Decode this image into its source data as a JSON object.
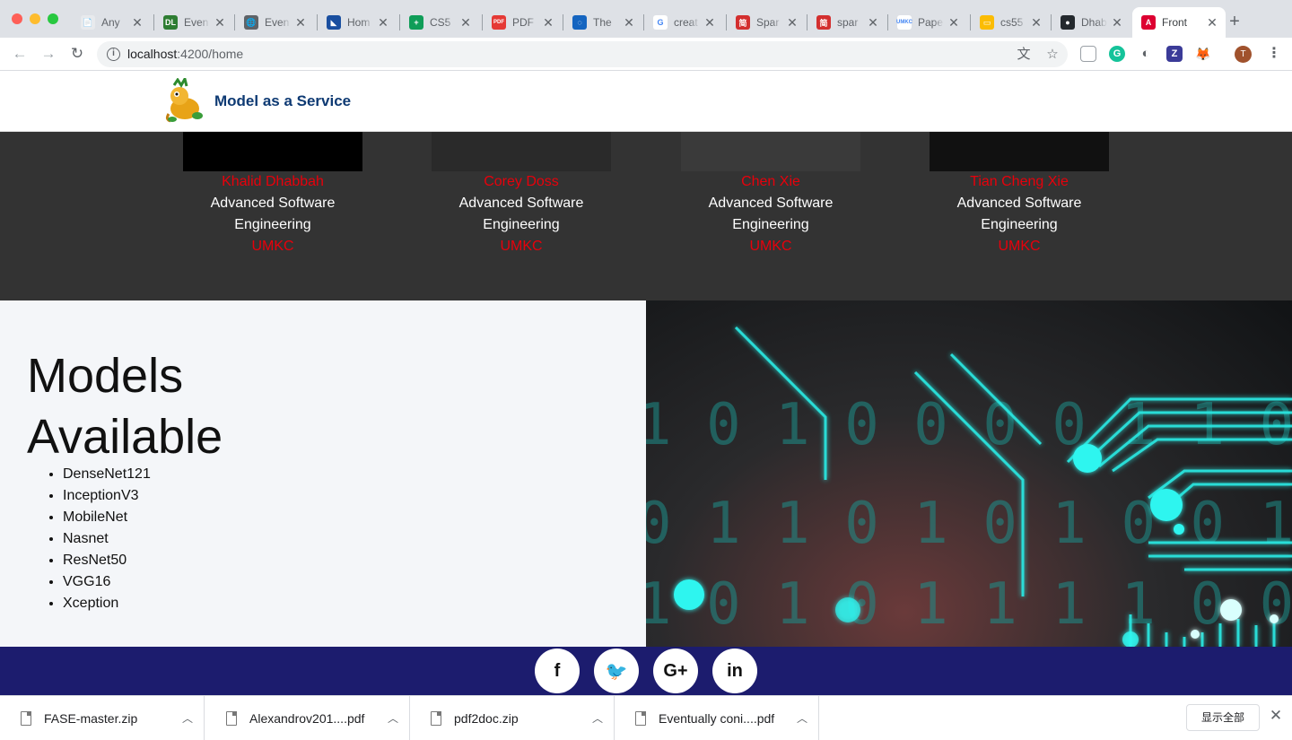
{
  "browser": {
    "tabs": [
      {
        "title": "Any",
        "fav_color": "#e8eaed",
        "fav_glyph": "📄"
      },
      {
        "title": "Even",
        "fav_color": "#2e7d32",
        "fav_glyph": "DL"
      },
      {
        "title": "Even",
        "fav_color": "#5f6368",
        "fav_glyph": "🌐"
      },
      {
        "title": "Hom",
        "fav_color": "#1a4fa0",
        "fav_glyph": "◣"
      },
      {
        "title": "CS5",
        "fav_color": "#0f9d58",
        "fav_glyph": "+"
      },
      {
        "title": "PDF",
        "fav_color": "#e53935",
        "fav_glyph": "PDF"
      },
      {
        "title": "The",
        "fav_color": "#1565c0",
        "fav_glyph": "◌"
      },
      {
        "title": "creat",
        "fav_color": "#ffffff",
        "fav_glyph": "G"
      },
      {
        "title": "Spar",
        "fav_color": "#d32f2f",
        "fav_glyph": "简"
      },
      {
        "title": "spar",
        "fav_color": "#d32f2f",
        "fav_glyph": "简"
      },
      {
        "title": "Pape",
        "fav_color": "#ffffff",
        "fav_glyph": "UMKC"
      },
      {
        "title": "cs55",
        "fav_color": "#fbbc04",
        "fav_glyph": "▭"
      },
      {
        "title": "Dhab",
        "fav_color": "#24292e",
        "fav_glyph": "●"
      },
      {
        "title": "Front",
        "fav_color": "#dd0031",
        "fav_glyph": "A"
      }
    ],
    "address": {
      "host": "localhost",
      "path": ":4200/home"
    }
  },
  "site": {
    "brand": "Model as a Service",
    "team": [
      {
        "name": "Khalid Dhabbah",
        "course": "Advanced Software Engineering",
        "school": "UMKC"
      },
      {
        "name": "Corey Doss",
        "course": "Advanced Software Engineering",
        "school": "UMKC"
      },
      {
        "name": "Chen Xie",
        "course": "Advanced Software Engineering",
        "school": "UMKC"
      },
      {
        "name": "Tian Cheng Xie",
        "course": "Advanced Software Engineering",
        "school": "UMKC"
      }
    ],
    "models_heading": "Models Available",
    "models": [
      "DenseNet121",
      "InceptionV3",
      "MobileNet",
      "Nasnet",
      "ResNet50",
      "VGG16",
      "Xception"
    ],
    "circuit_digits": [
      "1 0 1 0 0 0 0 1 1 0",
      "0 1 1 0 1 0 1 0 0 1 1",
      "1 0 1 0 1 1 1 1 0 0"
    ],
    "social": [
      {
        "icon": "facebook-icon",
        "glyph": "f"
      },
      {
        "icon": "twitter-icon",
        "glyph": "🐦"
      },
      {
        "icon": "google-plus-icon",
        "glyph": "G+"
      },
      {
        "icon": "linkedin-icon",
        "glyph": "in"
      }
    ]
  },
  "downloads": {
    "items": [
      "FASE-master.zip",
      "Alexandrov201....pdf",
      "pdf2doc.zip",
      "Eventually coni....pdf"
    ],
    "show_all": "显示全部"
  }
}
